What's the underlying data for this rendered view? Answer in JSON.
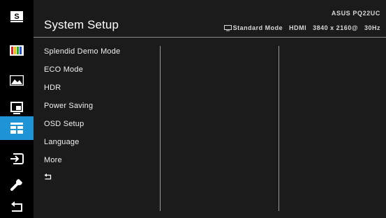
{
  "header": {
    "title": "System Setup",
    "model": "ASUS PQ22UC",
    "mode": "Standard Mode",
    "input": "HDMI",
    "resolution": "3840 x 2160@",
    "refresh": "30Hz"
  },
  "sidebar": {
    "items": [
      {
        "icon": "splendid-s-icon"
      },
      {
        "icon": "color-bars-icon"
      },
      {
        "icon": "image-icon"
      },
      {
        "icon": "pip-pbp-icon"
      },
      {
        "icon": "system-setup-icon",
        "active": true
      },
      {
        "icon": "input-select-icon"
      },
      {
        "icon": "wrench-icon"
      },
      {
        "icon": "back-arrow-icon"
      }
    ],
    "active_color": "#1e93d6"
  },
  "menu": {
    "items": [
      "Splendid Demo Mode",
      "ECO Mode",
      "HDR",
      "Power Saving",
      "OSD Setup",
      "Language",
      "More"
    ],
    "back_icon": "back-arrow-icon"
  }
}
